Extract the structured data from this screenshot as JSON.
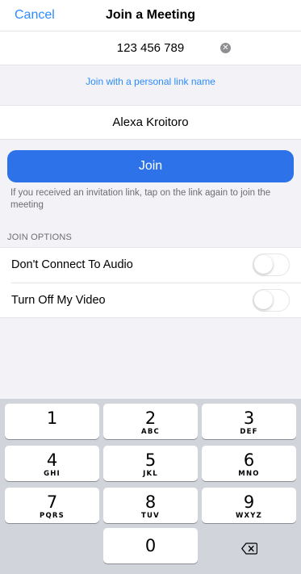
{
  "nav": {
    "cancel_label": "Cancel",
    "title": "Join a Meeting"
  },
  "meeting_id": {
    "value": "123 456 789",
    "clear_icon": "clear-circle-icon"
  },
  "personal_link_label": "Join with a personal link name",
  "name_field": {
    "value": "Alexa Kroitoro"
  },
  "join_label": "Join",
  "hint": "If you received an invitation link, tap on the link again to join the meeting",
  "options": {
    "header": "JOIN OPTIONS",
    "items": [
      {
        "label": "Don't Connect To Audio",
        "enabled": false
      },
      {
        "label": "Turn Off My Video",
        "enabled": false
      }
    ]
  },
  "keypad": {
    "keys": [
      {
        "digit": "1",
        "letters": ""
      },
      {
        "digit": "2",
        "letters": "ABC"
      },
      {
        "digit": "3",
        "letters": "DEF"
      },
      {
        "digit": "4",
        "letters": "GHI"
      },
      {
        "digit": "5",
        "letters": "JKL"
      },
      {
        "digit": "6",
        "letters": "MNO"
      },
      {
        "digit": "7",
        "letters": "PQRS"
      },
      {
        "digit": "8",
        "letters": "TUV"
      },
      {
        "digit": "9",
        "letters": "WXYZ"
      },
      {
        "digit": "0",
        "letters": ""
      }
    ],
    "delete_icon": "backspace-icon"
  },
  "colors": {
    "accent": "#2d8cff",
    "join_button": "#2d72e8",
    "background": "#f2f2f7"
  }
}
